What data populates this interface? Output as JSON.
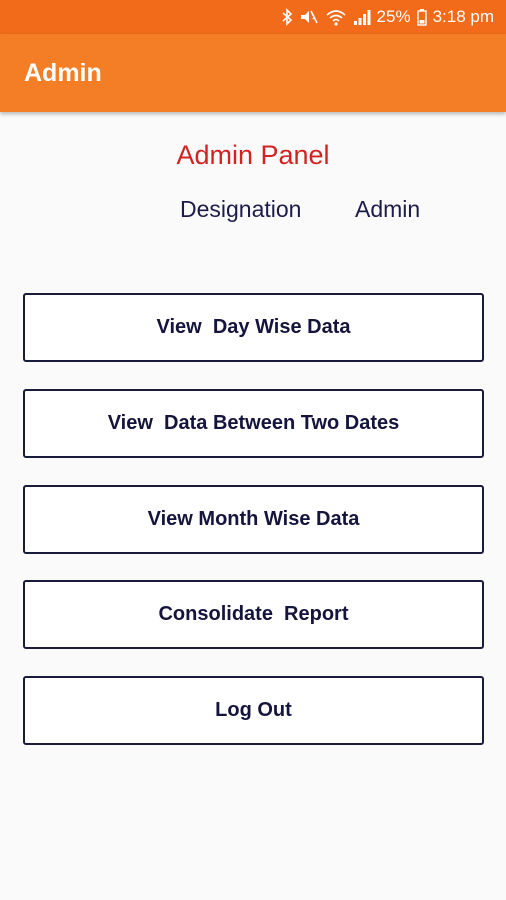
{
  "status_bar": {
    "battery": "25%",
    "time": "3:18 pm",
    "icons": [
      "bluetooth-icon",
      "mute-icon",
      "wifi-icon",
      "signal-icon",
      "battery-icon"
    ]
  },
  "app_bar": {
    "title": "Admin"
  },
  "panel": {
    "title": "Admin Panel",
    "designation_label": "Designation",
    "designation_value": "Admin"
  },
  "buttons": {
    "day_wise": "View  Day Wise Data",
    "between_dates": "View  Data Between Two Dates",
    "month_wise": "View Month Wise Data",
    "consolidate": "Consolidate  Report",
    "logout": "Log Out"
  },
  "colors": {
    "status_bar": "#f26b1a",
    "app_bar": "#f47e25",
    "panel_title": "#d32222",
    "button_text": "#14143c"
  }
}
